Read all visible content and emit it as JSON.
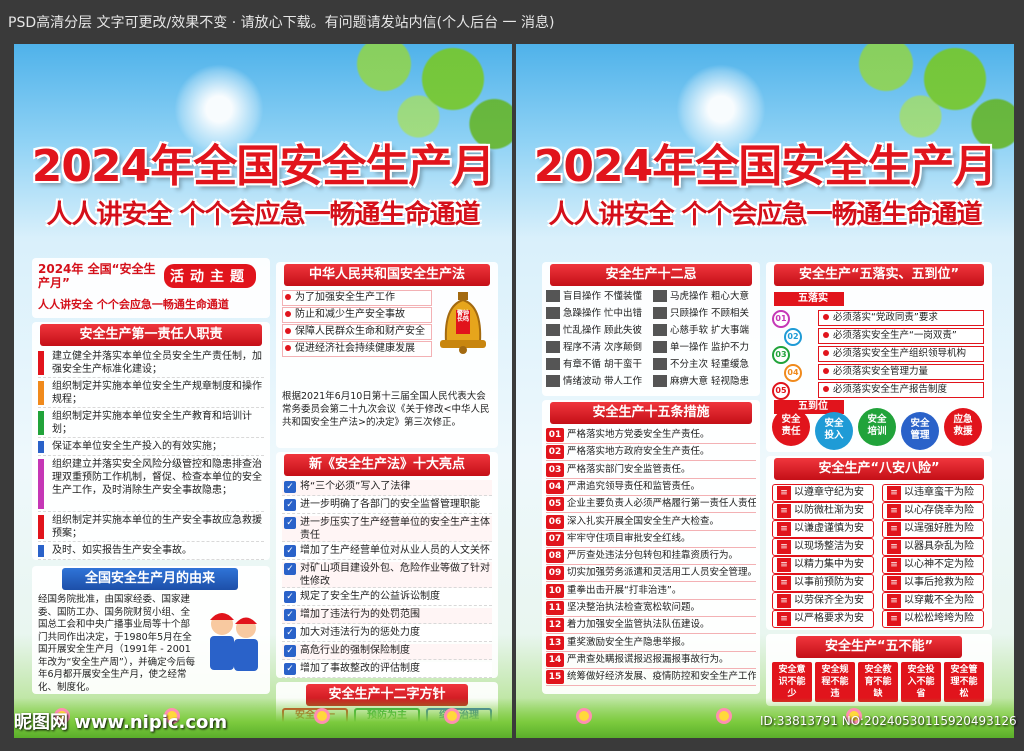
{
  "topbar": {
    "text": "PSD高清分层 文字可更改/效果不变 · 请放心下载。有问题请发站内信(个人后台 一 消息)"
  },
  "poster": {
    "title": "2024年全国安全生产月",
    "subtitle": "人人讲安全 个个会应急一畅通生命通道"
  },
  "left": {
    "theme_label": "2024年 全国“安全生产月”",
    "theme_tag": "活动主题",
    "theme_text": "人人讲安全 个个会应急一畅通生命通道",
    "duty_title": "安全生产第一责任人职责",
    "duty_items": [
      "建立健全并落实本单位全员安全生产责任制，加强安全生产标准化建设；",
      "组织制定并实施本单位安全生产规章制度和操作规程；",
      "组织制定并实施本单位安全生产教育和培训计划；",
      "保证本单位安全生产投入的有效实施；",
      "组织建立并落实安全风险分级管控和隐患排查治理双重预防工作机制，督促、检查本单位的安全生产工作，及时消除生产安全事故隐患；",
      "组织制定并实施本单位的生产安全事故应急救援预案；",
      "及时、如实报告生产安全事故。"
    ],
    "origin_title": "全国安全生产月的由来",
    "origin_text": "经国务院批准，由国家经委、国家建委、国防工办、国务院财贸小组、全国总工会和中央广播事业局等十个部门共同作出决定，于1980年5月在全国开展安全生产月（1991年 - 2001年改为“安全生产周”），并确定今后每年6月都开展安全生产月，使之经常化、制度化。",
    "law_title": "中华人民共和国安全生产法",
    "law_items": [
      "为了加强安全生产工作",
      "防止和减少生产安全事故",
      "保障人民群众生命和财产安全",
      "促进经济社会持续健康发展"
    ],
    "law_bell": "警钟长鸣",
    "law_note": "根据2021年6月10日第十三届全国人民代表大会常务委员会第二十九次会议《关于修改<中华人民共和国安全生产法>的决定》第三次修正。",
    "highlights_title": "新《安全生产法》十大亮点",
    "highlights": [
      "将“三个必须”写入了法律",
      "进一步明确了各部门的安全监督管理职能",
      "进一步压实了生产经营单位的安全生产主体责任",
      "增加了生产经营单位对从业人员的人文关怀",
      "对矿山项目建设外包、危险作业等做了针对性修改",
      "规定了安全生产的公益诉讼制度",
      "增加了违法行为的处罚范围",
      "加大对违法行为的惩处力度",
      "高危行业的强制保险制度",
      "增加了事故整改的评估制度"
    ],
    "policy_title": "安全生产十二字方针",
    "policy": [
      "安全第一",
      "预防为主",
      "综合治理"
    ]
  },
  "right": {
    "twelve_title": "安全生产十二忌",
    "twelve": [
      "盲目操作 不懂装懂",
      "马虎操作 粗心大意",
      "急躁操作 忙中出错",
      "只顾操作 不顾相关",
      "忙乱操作 顾此失彼",
      "心慈手软 扩大事端",
      "程序不清 次序颠倒",
      "单一操作 监护不力",
      "有章不循 胡干蛮干",
      "不分主次 轻重缓急",
      "情绪波动 带人工作",
      "麻痹大意 轻视隐患"
    ],
    "fifteen_title": "安全生产十五条措施",
    "fifteen": [
      "严格落实地方党委安全生产责任。",
      "严格落实地方政府安全生产责任。",
      "严格落实部门安全监管责任。",
      "严肃追究领导责任和监管责任。",
      "企业主要负责人必须严格履行第一责任人责任。",
      "深入扎实开展全国安全生产大检查。",
      "牢牢守住项目审批安全红线。",
      "严厉查处违法分包转包和挂靠资质行为。",
      "切实加强劳务派遣和灵活用工人员安全管理。",
      "重拳出击开展“打非治违”。",
      "坚决整治执法检查宽松软问题。",
      "着力加强安全监管执法队伍建设。",
      "重奖激励安全生产隐患举报。",
      "严肃查处瞒报谎报迟报漏报事故行为。",
      "统筹做好经济发展、疫情防控和安全生产工作。"
    ],
    "five_title": "安全生产“五落实、五到位”",
    "five_sub1": "五落实",
    "five_items": [
      "必须落实“党政同责”要求",
      "必须落实安全生产“一岗双责”",
      "必须落实安全生产组织领导机构",
      "必须落实安全管理力量",
      "必须落实安全生产报告制度"
    ],
    "five_nums": [
      "01",
      "02",
      "03",
      "04",
      "05"
    ],
    "five_sub2": "五到位",
    "five_tags": [
      "安全责任",
      "安全投入",
      "安全培训",
      "安全管理",
      "应急救援"
    ],
    "eight_title": "安全生产“八安八险”",
    "eight_left": [
      "以遵章守纪为安",
      "以防微杜渐为安",
      "以谦虚谨慎为安",
      "以现场整洁为安",
      "以精力集中为安",
      "以事前预防为安",
      "以劳保齐全为安",
      "以严格要求为安"
    ],
    "eight_right": [
      "以违章蛮干为险",
      "以心存侥幸为险",
      "以逞强好胜为险",
      "以器具杂乱为险",
      "以心神不定为险",
      "以事后抢救为险",
      "以穿戴不全为险",
      "以松松垮垮为险"
    ],
    "five_no_title": "安全生产“五不能”",
    "five_no": [
      "安全意识不能少",
      "安全规程不能违",
      "安全教育不能缺",
      "安全投入不能省",
      "安全管理不能松"
    ]
  },
  "footer": {
    "logo": "昵图网 www.nipic.com",
    "id": "ID:33813791 NO:20240530115920493126"
  },
  "colors": {
    "red": "#e1141c",
    "blue": "#2a62c9",
    "green": "#21a33a"
  }
}
